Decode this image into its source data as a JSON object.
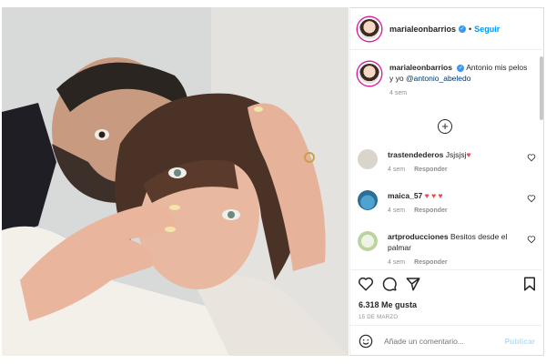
{
  "post": {
    "username": "marialeonbarrios",
    "follow_label": "Seguir",
    "separator": "•",
    "verified_glyph": "✓"
  },
  "caption": {
    "username": "marialeonbarrios",
    "text": "Antonio mis pelos y yo",
    "mention": "@antonio_abeledo",
    "time": "4 sem"
  },
  "load_more_icon": "plus-circle-icon",
  "load_more_glyph": "+",
  "comments": [
    {
      "username": "trastendederos",
      "text": "Jsjsjsj",
      "emoji": "♥",
      "time": "4 sem",
      "reply": "Responder",
      "avatar_color": "#d9d4cc"
    },
    {
      "username": "maica_57",
      "text": "",
      "emoji": "♥ ♥ ♥",
      "time": "4 sem",
      "reply": "Responder",
      "avatar_color": "#3b8fc2"
    },
    {
      "username": "artproducciones",
      "text": "Besitos desde el palmar",
      "emoji": "",
      "time": "4 sem",
      "reply": "Responder",
      "avatar_color": "#c9dcb0"
    }
  ],
  "actions": {
    "like_icon": "heart-icon",
    "comment_icon": "comment-icon",
    "share_icon": "paper-plane-icon",
    "save_icon": "bookmark-icon",
    "likes": "6.318 Me gusta",
    "date": "15 DE MARZO"
  },
  "add_comment": {
    "placeholder": "Añade un comentario...",
    "publish_label": "Publicar",
    "emoji_icon": "smiley-icon"
  },
  "colors": {
    "accent": "#0095f6",
    "verified": "#3897f0",
    "heart_red": "#ed4956",
    "muted": "#8e8e8e"
  }
}
